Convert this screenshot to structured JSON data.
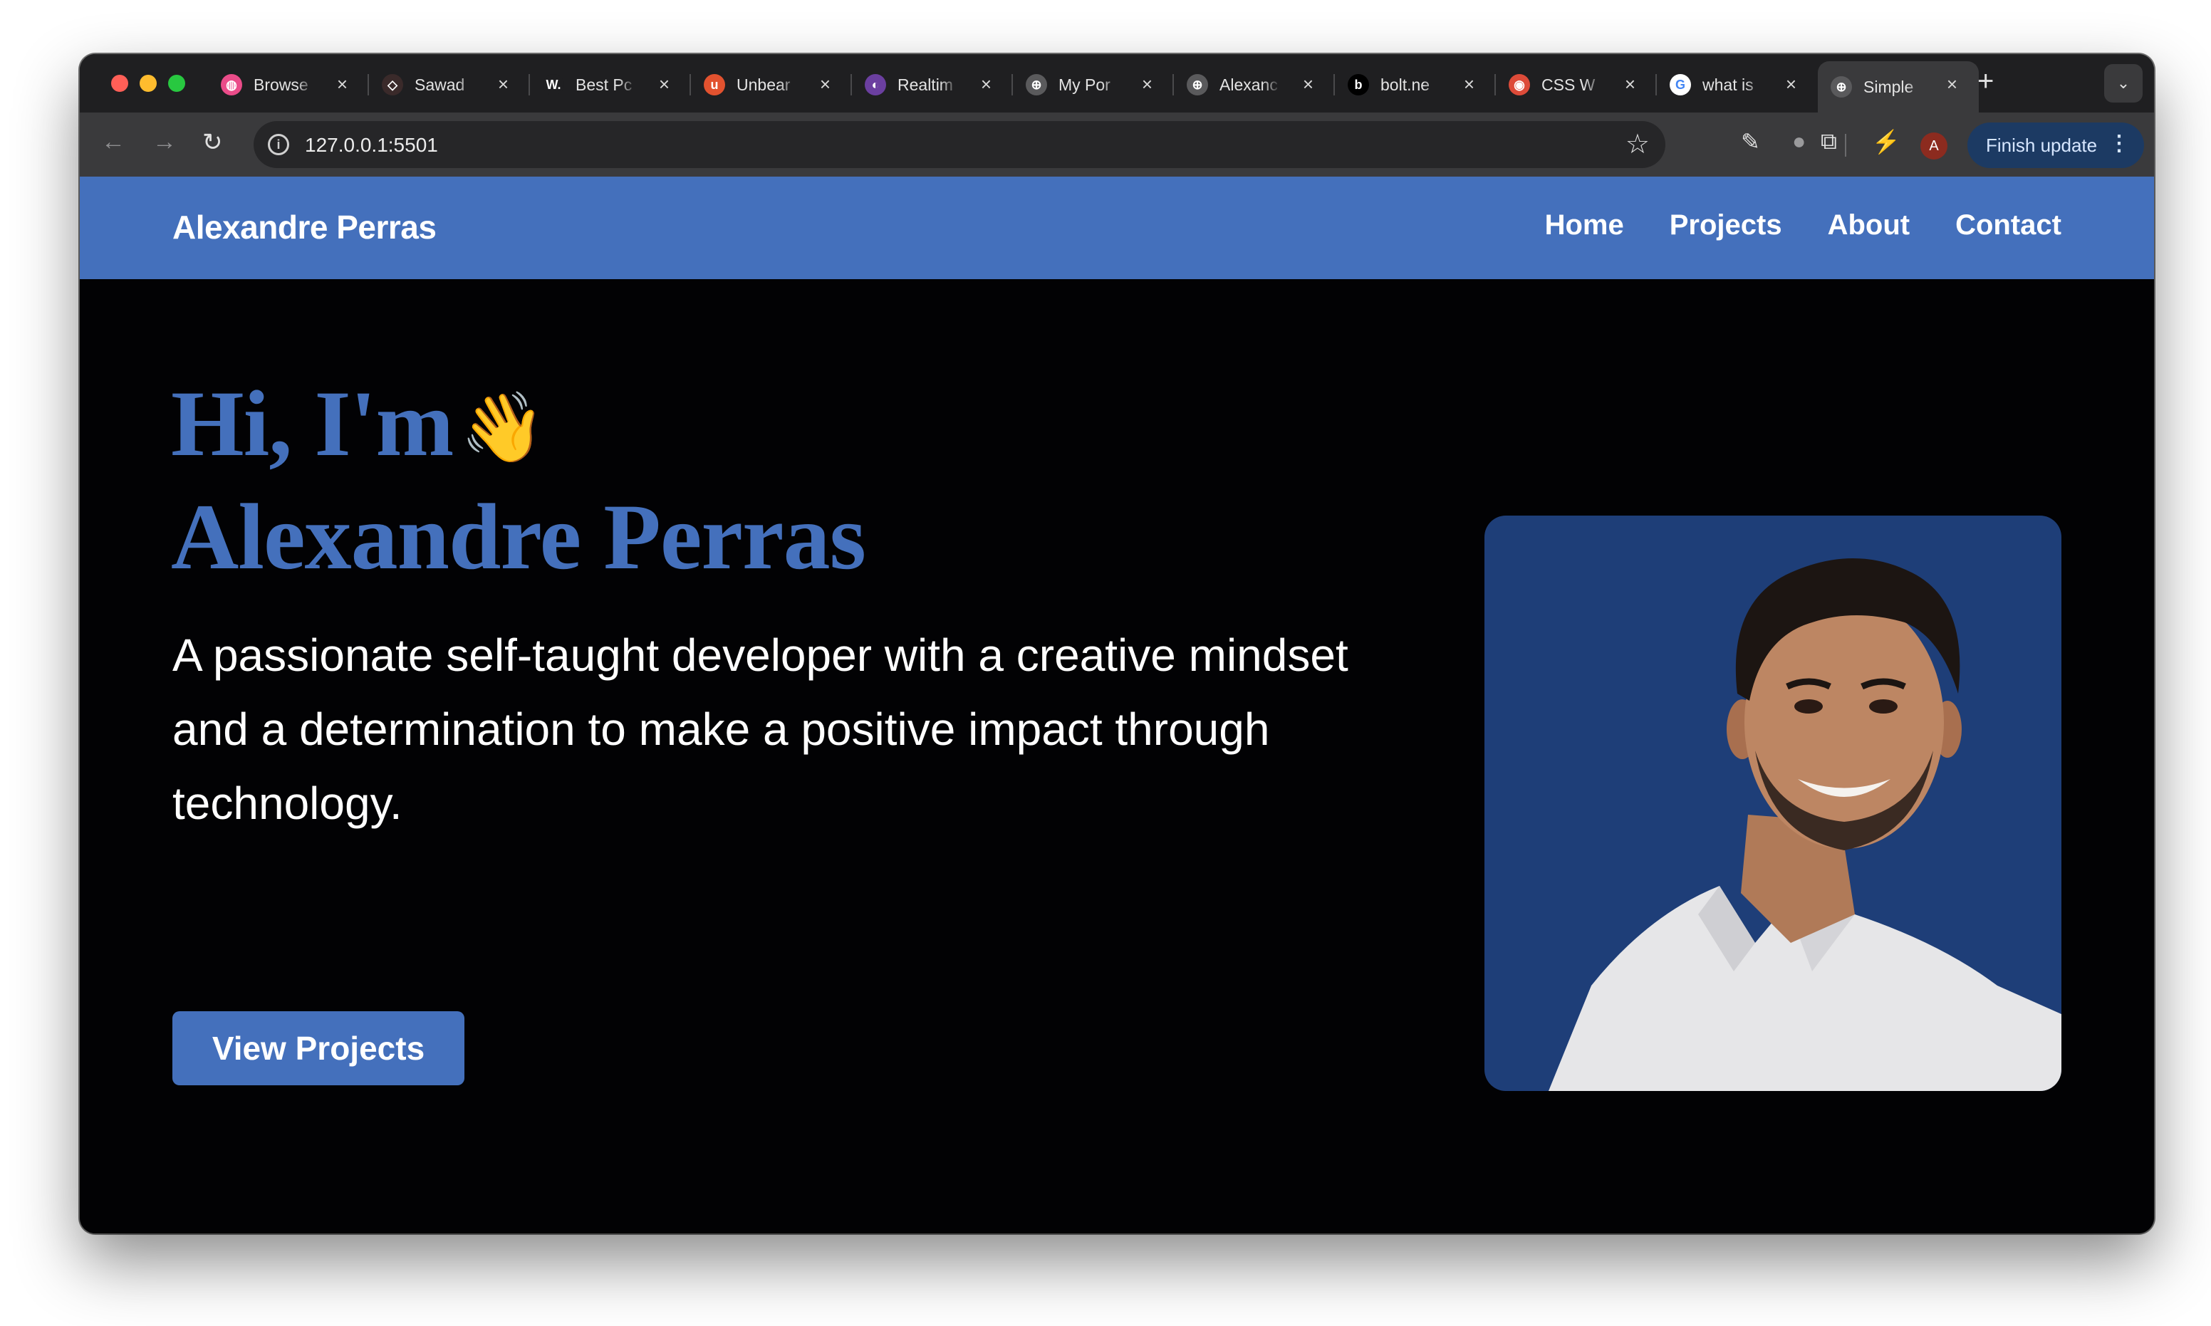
{
  "browser": {
    "tabs": [
      {
        "title": "Browse",
        "favicon": "dribbble-icon",
        "color": "#ea4c89",
        "glyph": "◍"
      },
      {
        "title": "Sawad",
        "favicon": "diamond-icon",
        "color": "#3a2a2a",
        "glyph": "◇"
      },
      {
        "title": "Best Pc",
        "favicon": "w-icon",
        "color": "#1f1f21",
        "glyph": "W."
      },
      {
        "title": "Unbear",
        "favicon": "u-icon",
        "color": "#e2522f",
        "glyph": "u"
      },
      {
        "title": "Realtim",
        "favicon": "realtime-icon",
        "color": "#6b3fa0",
        "glyph": "◐"
      },
      {
        "title": "My Por",
        "favicon": "globe-icon",
        "color": "#5a5a5c",
        "glyph": "⊕"
      },
      {
        "title": "Alexanc",
        "favicon": "globe-icon",
        "color": "#5a5a5c",
        "glyph": "⊕"
      },
      {
        "title": "bolt.ne",
        "favicon": "bolt-icon",
        "color": "#000000",
        "glyph": "b"
      },
      {
        "title": "CSS W",
        "favicon": "chrome-icon",
        "color": "#dd4b39",
        "glyph": "◉"
      },
      {
        "title": "what is",
        "favicon": "google-icon",
        "color": "#ffffff",
        "glyph": "G"
      },
      {
        "title": "Simple",
        "favicon": "globe-icon",
        "color": "#5a5a5c",
        "glyph": "⊕",
        "active": true
      }
    ],
    "new_tab": "+",
    "url": "127.0.0.1:5501",
    "update_button": "Finish update",
    "profile_initial": "A"
  },
  "site": {
    "brand": "Alexandre Perras",
    "nav": [
      "Home",
      "Projects",
      "About",
      "Contact"
    ],
    "hero": {
      "greeting": "Hi, I'm",
      "wave": "👋",
      "name": "Alexandre Perras",
      "tagline": "A passionate self-taught developer with a creative mindset and a determination to make a positive impact through technology.",
      "cta": "View Projects"
    },
    "colors": {
      "accent": "#4470bc",
      "background": "#020204",
      "photo_bg": "#1e3e78"
    }
  }
}
